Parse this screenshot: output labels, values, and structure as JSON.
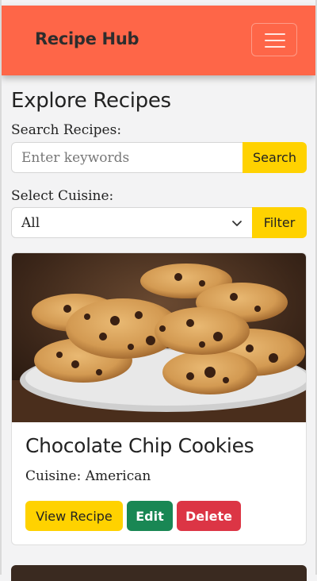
{
  "navbar": {
    "brand": "Recipe Hub",
    "toggler_icon": "hamburger-icon"
  },
  "page": {
    "title": "Explore Recipes"
  },
  "search": {
    "label": "Search Recipes:",
    "placeholder": "Enter keywords",
    "button": "Search"
  },
  "cuisine": {
    "label": "Select Cuisine:",
    "selected": "All",
    "button": "Filter"
  },
  "recipes": [
    {
      "title": "Chocolate Chip Cookies",
      "cuisine": "Cuisine: American",
      "image": "chocolate-chip-cookies-photo",
      "buttons": {
        "view": "View Recipe",
        "edit": "Edit",
        "delete": "Delete"
      }
    }
  ],
  "colors": {
    "navbar": "#fe6648",
    "accent": "#ffd200",
    "edit": "#198754",
    "delete": "#dc3545"
  }
}
